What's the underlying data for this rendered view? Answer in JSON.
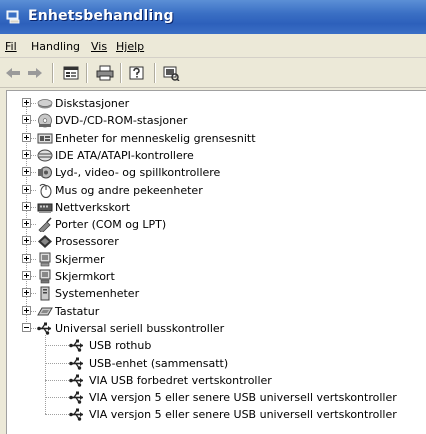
{
  "window": {
    "title": "Enhetsbehandling"
  },
  "menubar": {
    "items": [
      {
        "label": "Fil",
        "accel": "F"
      },
      {
        "label": "Handling",
        "accel": "n"
      },
      {
        "label": "Vis",
        "accel": "V"
      },
      {
        "label": "Hjelp",
        "accel": "H"
      }
    ]
  },
  "toolbar": {
    "buttons": [
      "back-arrow-icon",
      "forward-arrow-icon",
      "properties-icon",
      "print-icon",
      "help-icon",
      "scan-hardware-icon"
    ]
  },
  "tree": {
    "categories": [
      {
        "label": "Diskstasjoner",
        "icon": "disk-drive-icon"
      },
      {
        "label": "DVD-/CD-ROM-stasjoner",
        "icon": "cdrom-icon"
      },
      {
        "label": "Enheter for menneskelig grensesnitt",
        "icon": "hid-icon"
      },
      {
        "label": "IDE ATA/ATAPI-kontrollere",
        "icon": "ide-controller-icon"
      },
      {
        "label": "Lyd-, video- og spillkontrollere",
        "icon": "sound-icon"
      },
      {
        "label": "Mus og andre pekeenheter",
        "icon": "mouse-icon"
      },
      {
        "label": "Nettverkskort",
        "icon": "network-card-icon"
      },
      {
        "label": "Porter (COM og LPT)",
        "icon": "port-icon"
      },
      {
        "label": "Prosessorer",
        "icon": "processor-icon"
      },
      {
        "label": "Skjermer",
        "icon": "monitor-icon"
      },
      {
        "label": "Skjermkort",
        "icon": "display-adapter-icon"
      },
      {
        "label": "Systemenheter",
        "icon": "system-device-icon"
      },
      {
        "label": "Tastatur",
        "icon": "keyboard-icon"
      },
      {
        "label": "Universal seriell busskontroller",
        "icon": "usb-icon",
        "expanded": true
      }
    ],
    "usb_children": [
      {
        "label": "USB rothub"
      },
      {
        "label": "USB-enhet (sammensatt)"
      },
      {
        "label": "VIA USB forbedret vertskontroller"
      },
      {
        "label": "VIA versjon 5 eller senere USB universell vertskontroller"
      },
      {
        "label": "VIA versjon 5 eller senere USB universell vertskontroller"
      }
    ]
  }
}
